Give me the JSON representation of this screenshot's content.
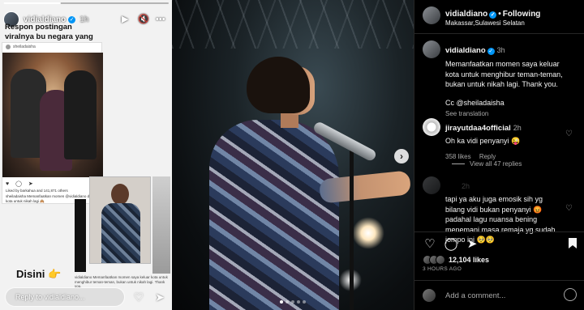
{
  "story": {
    "username": "vidialdiano",
    "time": "1h",
    "caption": "Respon postingan viralnya bu negara yang ini...",
    "card_username": "sheiladaisha",
    "card_liked_by": "Liked by barkahua and 141,871 others",
    "card_caption": "sheiladaisha Memanfaatkan momen @vidialdiano di luar kota untuk nikah lagi 🙈",
    "disini": "Disini 👉",
    "tiny_caption": "vidialdiano Memanfaatkan momen saya keluar kota untuk menghibur teman-teman, bukan untuk nikah lagi. Thank you.",
    "reply_placeholder": "Reply to vidialdiano..."
  },
  "post": {
    "username": "vidialdiano",
    "follow_label": "Following",
    "location": "Makassar,Sulawesi Selatan",
    "caption": {
      "username": "vidialdiano",
      "time": "3h",
      "lines": [
        "Memanfaatkan momen saya keluar",
        "kota untuk menghibur teman-teman,",
        "bukan untuk nikah lagi. Thank you.",
        "",
        "Cc @sheiladaisha"
      ],
      "see_translation": "See translation"
    },
    "comments": [
      {
        "username": "jirayutdaa4official",
        "time": "2h",
        "text": "Oh ka vidi penyanyi 😜",
        "likes": "358 likes",
        "reply": "Reply",
        "view_replies": "View all 47 replies"
      },
      {
        "username": "",
        "time": "2h",
        "lines": [
          "tapi ya aku juga emosik sih yg",
          "bilang vidi bukan penyanyi 😡",
          "padahal lagu nuansa bening",
          "menemani masa remaja yg sudah",
          "jompo ini 🥺🥺"
        ]
      }
    ],
    "likes": "12,104 likes",
    "ago": "3 HOURS AGO",
    "add_comment_placeholder": "Add a comment..."
  }
}
